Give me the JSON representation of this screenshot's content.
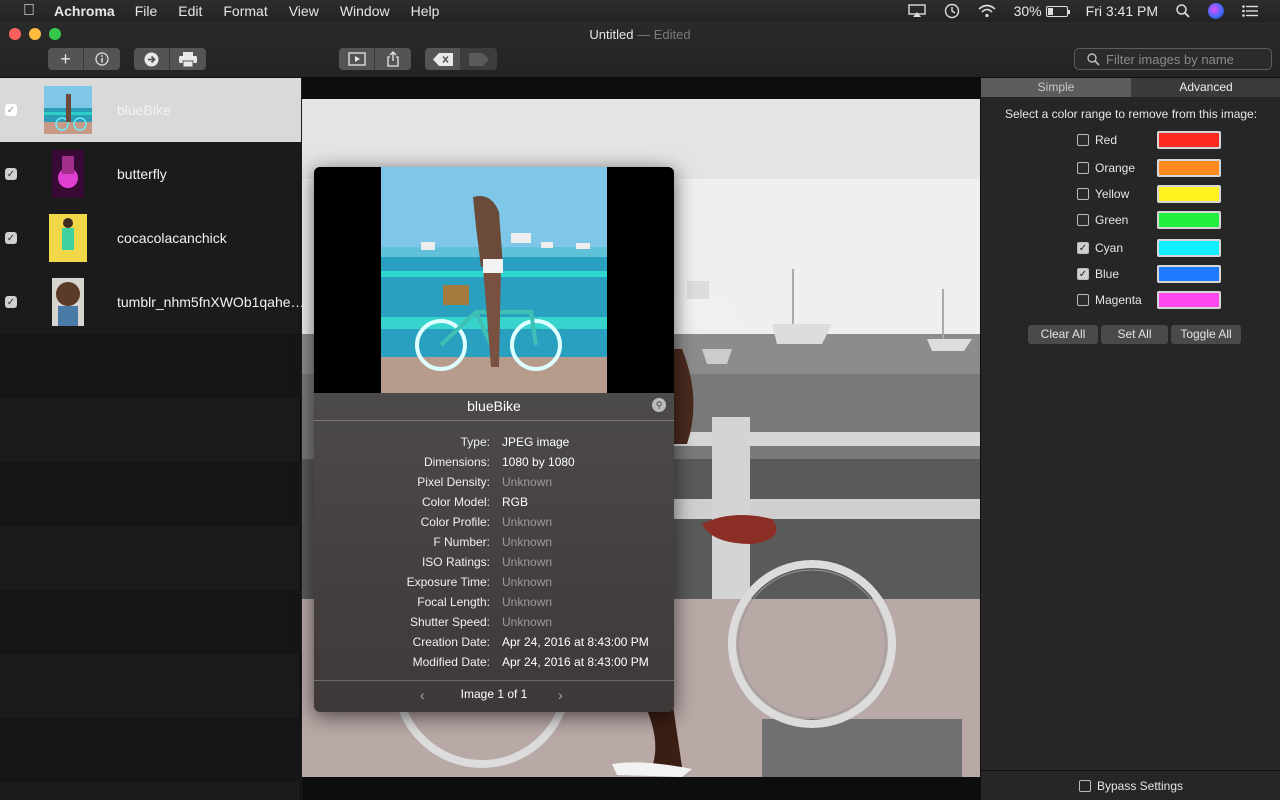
{
  "menubar": {
    "app_name": "Achroma",
    "items": [
      "File",
      "Edit",
      "Format",
      "View",
      "Window",
      "Help"
    ],
    "battery_percent": "30%",
    "battery_level": 0.3,
    "clock": "Fri 3:41 PM"
  },
  "window": {
    "title": "Untitled",
    "edited": "— Edited"
  },
  "toolbar": {
    "filter_placeholder": "Filter images by name"
  },
  "sidebar": {
    "items": [
      {
        "name": "blueBike",
        "checked": true,
        "selected": true
      },
      {
        "name": "butterfly",
        "checked": true,
        "selected": false
      },
      {
        "name": "cocacolacanchick",
        "checked": true,
        "selected": false
      },
      {
        "name": "tumblr_nhm5fnXWOb1qahe…",
        "checked": true,
        "selected": false
      }
    ]
  },
  "panel": {
    "tabs": [
      "Simple",
      "Advanced"
    ],
    "instruction": "Select a color range to remove from this image:",
    "colors": [
      {
        "label": "Red",
        "checked": false,
        "swatch": "#ff2a1f"
      },
      {
        "label": "Orange",
        "checked": false,
        "swatch": "#ff8a1f"
      },
      {
        "label": "Yellow",
        "checked": false,
        "swatch": "#fff21f"
      },
      {
        "label": "Green",
        "checked": false,
        "swatch": "#22f03c"
      },
      {
        "label": "Cyan",
        "checked": true,
        "swatch": "#12f0ff"
      },
      {
        "label": "Blue",
        "checked": true,
        "swatch": "#1f7aff"
      },
      {
        "label": "Magenta",
        "checked": false,
        "swatch": "#ff48f0"
      }
    ],
    "buttons": {
      "clear": "Clear  All",
      "set": "Set All",
      "toggle": "Toggle All"
    },
    "bypass": "Bypass Settings"
  },
  "inspector": {
    "title": "blueBike",
    "fields": [
      {
        "key": "Type:",
        "value": "JPEG image",
        "unknown": false
      },
      {
        "key": "Dimensions:",
        "value": "1080 by 1080",
        "unknown": false
      },
      {
        "key": "Pixel Density:",
        "value": "Unknown",
        "unknown": true
      },
      {
        "key": "Color Model:",
        "value": "RGB",
        "unknown": false
      },
      {
        "key": "Color Profile:",
        "value": "Unknown",
        "unknown": true
      },
      {
        "key": "F Number:",
        "value": "Unknown",
        "unknown": true
      },
      {
        "key": "ISO Ratings:",
        "value": "Unknown",
        "unknown": true
      },
      {
        "key": "Exposure Time:",
        "value": "Unknown",
        "unknown": true
      },
      {
        "key": "Focal Length:",
        "value": "Unknown",
        "unknown": true
      },
      {
        "key": "Shutter Speed:",
        "value": "Unknown",
        "unknown": true
      },
      {
        "key": "Creation Date:",
        "value": "Apr 24, 2016 at 8:43:00 PM",
        "unknown": false
      },
      {
        "key": "Modified Date:",
        "value": "Apr 24, 2016 at 8:43:00 PM",
        "unknown": false
      }
    ],
    "pager": "Image 1 of 1"
  }
}
